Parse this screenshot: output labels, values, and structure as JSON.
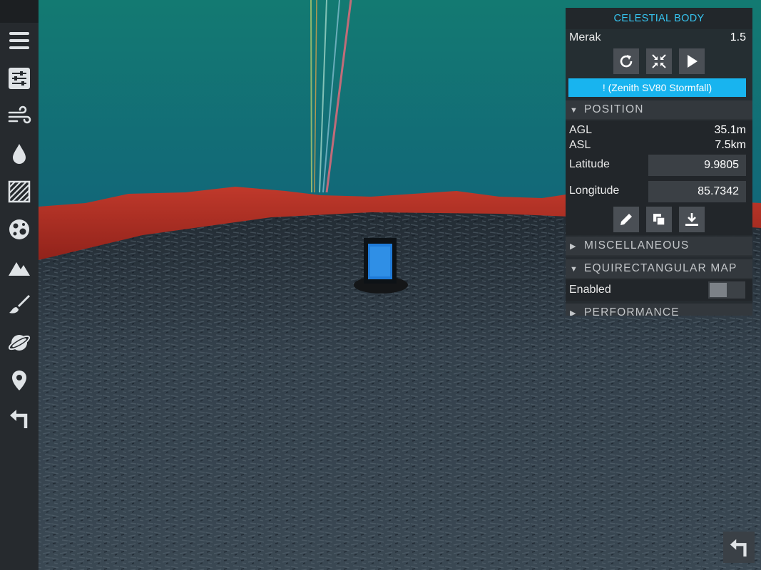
{
  "sidebar": {
    "items": [
      {
        "name": "menu-icon"
      },
      {
        "name": "sliders-icon"
      },
      {
        "name": "wind-icon"
      },
      {
        "name": "water-drop-icon"
      },
      {
        "name": "hatch-texture-icon"
      },
      {
        "name": "crater-icon"
      },
      {
        "name": "mountains-icon"
      },
      {
        "name": "paintbrush-icon"
      },
      {
        "name": "planet-icon"
      },
      {
        "name": "map-pin-icon"
      },
      {
        "name": "back-arrow-icon"
      }
    ]
  },
  "panel": {
    "title": "CELESTIAL BODY",
    "body_name": "Merak",
    "body_value": "1.5",
    "active_craft_button": "! (Zenith SV80 Stormfall)",
    "position": {
      "header": "POSITION",
      "agl_label": "AGL",
      "agl_value": "35.1m",
      "asl_label": "ASL",
      "asl_value": "7.5km",
      "latitude_label": "Latitude",
      "latitude_value": "9.9805",
      "longitude_label": "Longitude",
      "longitude_value": "85.7342"
    },
    "misc_header": "MISCELLANEOUS",
    "equirect": {
      "header": "EQUIRECTANGULAR MAP",
      "enabled_label": "Enabled",
      "enabled": false
    },
    "performance_header": "PERFORMANCE"
  },
  "colors": {
    "accent": "#36c4f0",
    "button_blue": "#18b4ef",
    "sky_top": "#137a72",
    "sky_horizon": "#0c2f6a",
    "terrain_red": "#b8261f",
    "ground": "#2f3a44"
  }
}
